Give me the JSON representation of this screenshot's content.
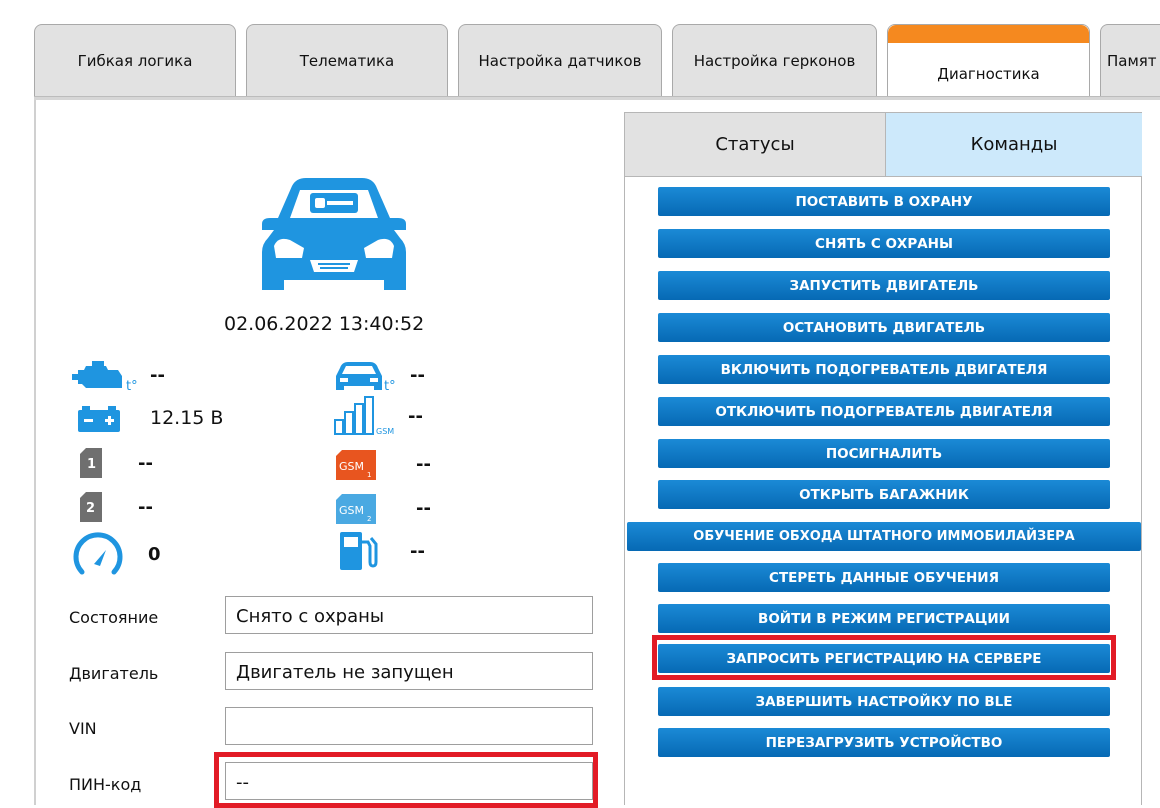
{
  "top_tabs": [
    {
      "label": "Гибкая логика"
    },
    {
      "label": "Телематика"
    },
    {
      "label": "Настройка датчиков"
    },
    {
      "label": "Настройка герконов"
    },
    {
      "label": "Диагностика"
    },
    {
      "label": "Памят"
    }
  ],
  "active_tab": "Диагностика",
  "accent_color": "#f5891f",
  "device": {
    "datetime": "02.06.2022  13:40:52",
    "indicators": {
      "engine_temp": "--",
      "cabin_temp": "--",
      "battery": "12.15 В",
      "gsm_signal": "--",
      "sim1": "--",
      "gsm1": "--",
      "sim2": "--",
      "gsm2": "--",
      "speed": "0",
      "fuel": "--"
    },
    "badge_text": {
      "sim1": "1",
      "sim2": "2",
      "gsm": "GSM",
      "gsm1_sub": "1",
      "gsm2_sub": "2",
      "signal_sub": "GSM",
      "temp": "t°"
    },
    "form": {
      "state_label": "Состояние",
      "state_value": "Снято с охраны",
      "engine_label": "Двигатель",
      "engine_value": "Двигатель не запущен",
      "vin_label": "VIN",
      "vin_value": "",
      "pin_label": "ПИН-код",
      "pin_value": "--"
    }
  },
  "right_panel": {
    "tabs": {
      "status": "Статусы",
      "commands": "Команды"
    },
    "commands": [
      "ПОСТАВИТЬ В ОХРАНУ",
      "СНЯТЬ С ОХРАНЫ",
      "ЗАПУСТИТЬ ДВИГАТЕЛЬ",
      "ОСТАНОВИТЬ ДВИГАТЕЛЬ",
      "ВКЛЮЧИТЬ ПОДОГРЕВАТЕЛЬ ДВИГАТЕЛЯ",
      "ОТКЛЮЧИТЬ ПОДОГРЕВАТЕЛЬ ДВИГАТЕЛЯ",
      "ПОСИГНАЛИТЬ",
      "ОТКРЫТЬ БАГАЖНИК",
      "ОБУЧЕНИЕ ОБХОДА ШТАТНОГО ИММОБИЛАЙЗЕРА",
      "СТЕРЕТЬ ДАННЫЕ ОБУЧЕНИЯ",
      "ВОЙТИ В РЕЖИМ РЕГИСТРАЦИИ",
      "ЗАПРОСИТЬ РЕГИСТРАЦИЮ НА СЕРВЕРЕ",
      "ЗАВЕРШИТЬ НАСТРОЙКУ ПО BLE",
      "ПЕРЕЗАГРУЗИТЬ УСТРОЙСТВО"
    ]
  },
  "colors": {
    "icon_blue": "#1f95e0",
    "button_blue": "#0b76c6",
    "highlight_red": "#e21b26",
    "gsm1_orange": "#e8551f",
    "gsm2_blue": "#4aa9e2",
    "sim_gray": "#6f6f6f"
  }
}
